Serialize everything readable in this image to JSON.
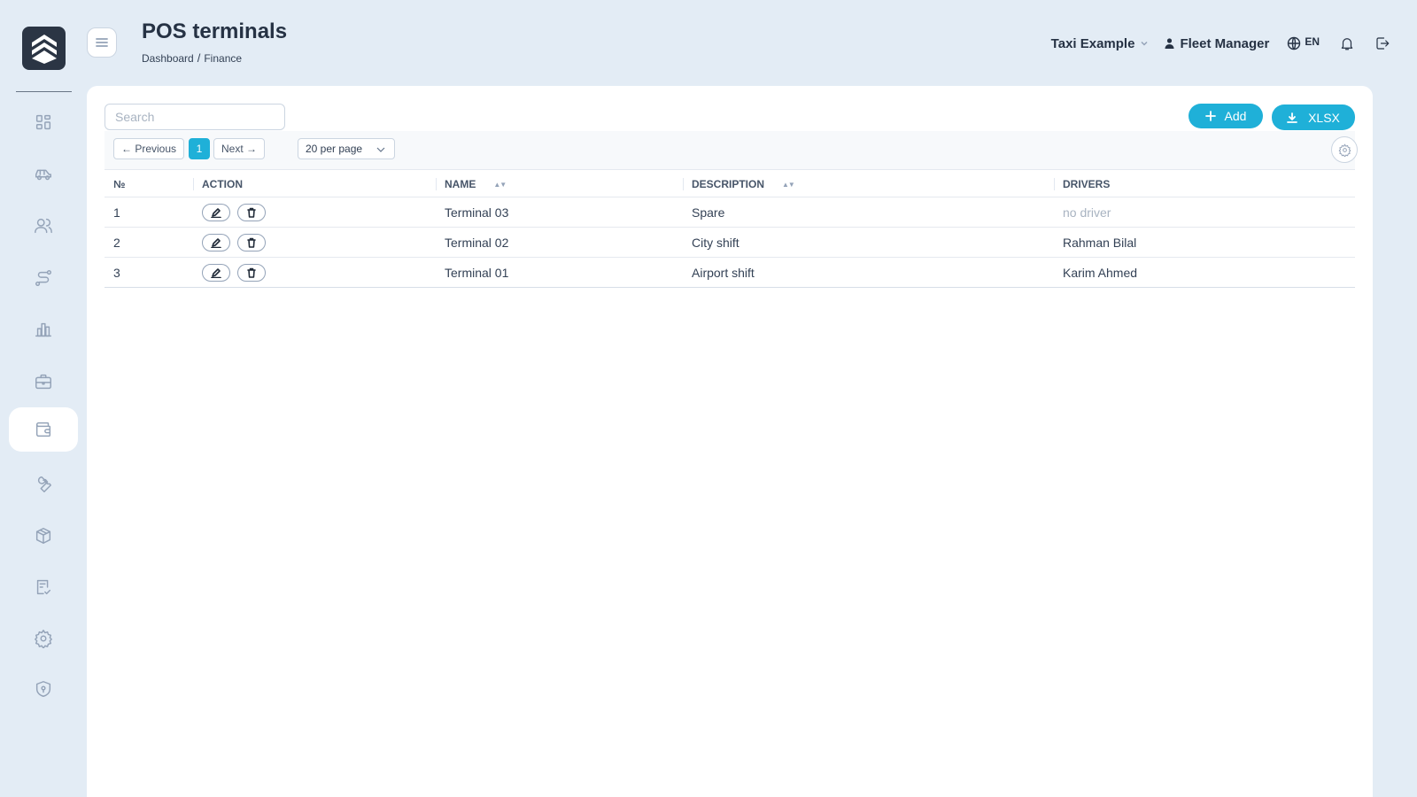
{
  "header": {
    "title": "POS terminals",
    "breadcrumb": [
      "Dashboard",
      "Finance"
    ],
    "breadcrumb_sep": "/",
    "company": "Taxi Example",
    "user": "Fleet Manager",
    "language": "EN"
  },
  "sidebar": {
    "items": [
      {
        "icon": "dashboard-icon",
        "active": false
      },
      {
        "icon": "car-icon",
        "active": false
      },
      {
        "icon": "users-icon",
        "active": false
      },
      {
        "icon": "route-icon",
        "active": false
      },
      {
        "icon": "chart-icon",
        "active": false
      },
      {
        "icon": "briefcase-icon",
        "active": false
      },
      {
        "icon": "wallet-icon",
        "active": true
      },
      {
        "icon": "wrench-icon",
        "active": false
      },
      {
        "icon": "box-icon",
        "active": false
      },
      {
        "icon": "checklist-icon",
        "active": false
      },
      {
        "icon": "gear-icon",
        "active": false
      },
      {
        "icon": "shield-icon",
        "active": false
      }
    ]
  },
  "toolbar": {
    "search_placeholder": "Search",
    "add_label": "Add",
    "export_label": "XLSX",
    "prev_label": "← Previous",
    "next_label": "Next →",
    "current_page": "1",
    "per_page": "20 per page"
  },
  "table": {
    "columns": [
      "№",
      "ACTION",
      "NAME",
      "DESCRIPTION",
      "DRIVERS"
    ],
    "rows": [
      {
        "num": "1",
        "name": "Terminal 03",
        "description": "Spare",
        "drivers": "no driver",
        "no_driver": true
      },
      {
        "num": "2",
        "name": "Terminal 02",
        "description": "City shift",
        "drivers": "Rahman Bilal",
        "no_driver": false
      },
      {
        "num": "3",
        "name": "Terminal 01",
        "description": "Airport shift",
        "drivers": "Karim Ahmed",
        "no_driver": false
      }
    ]
  },
  "colors": {
    "accent": "#1fb0d8",
    "background": "#e3ecf5",
    "logo": "#2b3544"
  }
}
